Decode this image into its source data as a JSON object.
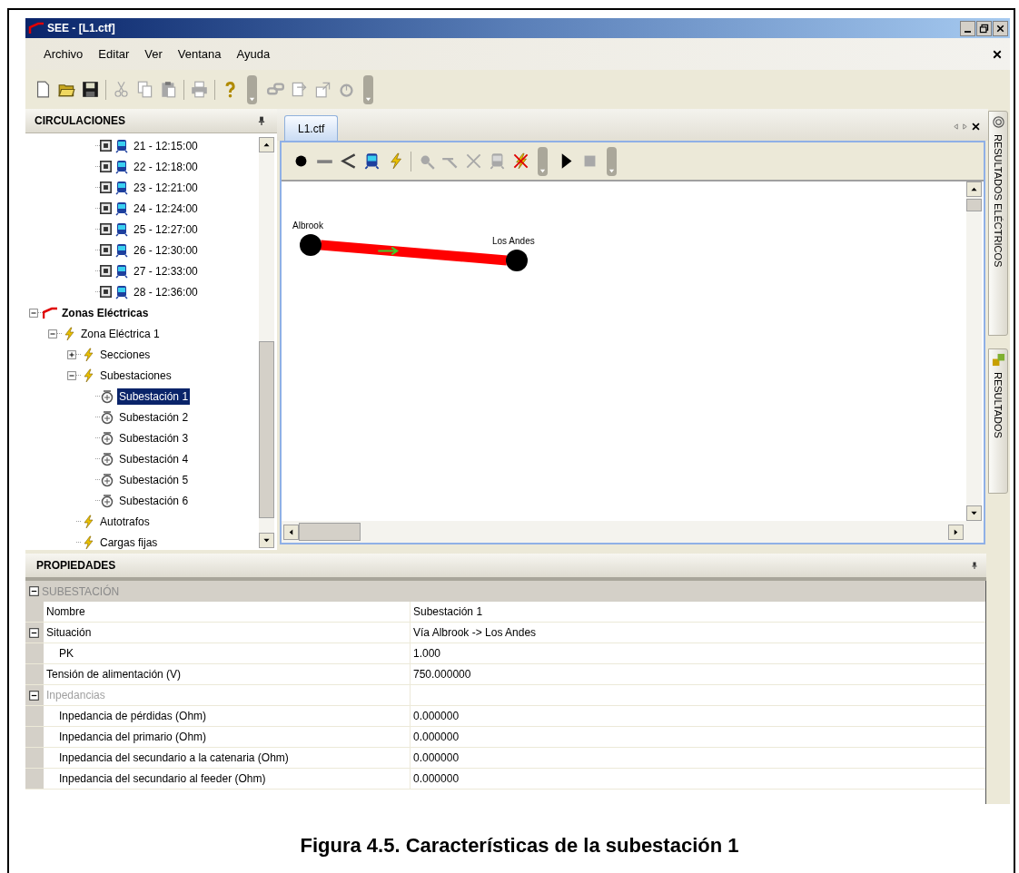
{
  "window": {
    "title": "SEE - [L1.ctf]"
  },
  "menu": [
    "Archivo",
    "Editar",
    "Ver",
    "Ventana",
    "Ayuda"
  ],
  "toolbars": [
    {
      "buttons": [
        {
          "kind": "new",
          "disabled": false
        },
        {
          "kind": "open",
          "disabled": false
        },
        {
          "kind": "save",
          "disabled": false
        },
        {
          "kind": "separator"
        },
        {
          "kind": "cut",
          "disabled": true
        },
        {
          "kind": "copy",
          "disabled": true
        },
        {
          "kind": "paste",
          "disabled": true
        },
        {
          "kind": "separator"
        },
        {
          "kind": "print",
          "disabled": true
        },
        {
          "kind": "separator"
        },
        {
          "kind": "help",
          "disabled": false
        }
      ]
    },
    {
      "buttons": [
        {
          "kind": "link",
          "disabled": true
        },
        {
          "kind": "import",
          "disabled": true
        },
        {
          "kind": "export",
          "disabled": true
        },
        {
          "kind": "probe",
          "disabled": true
        }
      ]
    }
  ],
  "left_panel": {
    "title": "CIRCULACIONES",
    "tree": {
      "scrolled_items": [
        {
          "label": "21 - 12:15:00",
          "checked": true,
          "selected": false
        },
        {
          "label": "22 - 12:18:00",
          "checked": true,
          "selected": false
        },
        {
          "label": "23 - 12:21:00",
          "checked": true,
          "selected": false
        },
        {
          "label": "24 - 12:24:00",
          "checked": true,
          "selected": false
        },
        {
          "label": "25 - 12:27:00",
          "checked": true,
          "selected": false
        },
        {
          "label": "26 - 12:30:00",
          "checked": true,
          "selected": false
        },
        {
          "label": "27 - 12:33:00",
          "checked": true,
          "selected": false
        },
        {
          "label": "28 - 12:36:00",
          "checked": true,
          "selected": false
        }
      ],
      "items": [
        {
          "label": "Zonas Eléctricas",
          "kind": "zones",
          "expanded": true,
          "selected": false,
          "children": [
            {
              "label": "Zona Eléctrica 1",
              "kind": "zone",
              "expanded": true,
              "selected": false,
              "children": [
                {
                  "label": "Secciones",
                  "kind": "zone",
                  "expanded": false,
                  "selected": false
                },
                {
                  "label": "Subestaciones",
                  "kind": "zone",
                  "expanded": true,
                  "selected": false,
                  "children": [
                    {
                      "label": "Subestación 1",
                      "kind": "substation",
                      "selected": true
                    },
                    {
                      "label": "Subestación 2",
                      "kind": "substation",
                      "selected": false
                    },
                    {
                      "label": "Subestación 3",
                      "kind": "substation",
                      "selected": false
                    },
                    {
                      "label": "Subestación 4",
                      "kind": "substation",
                      "selected": false
                    },
                    {
                      "label": "Subestación 5",
                      "kind": "substation",
                      "selected": false
                    },
                    {
                      "label": "Subestación 6",
                      "kind": "substation",
                      "selected": false
                    }
                  ]
                },
                {
                  "label": "Autotrafos",
                  "kind": "zone",
                  "selected": false
                },
                {
                  "label": "Cargas fijas",
                  "kind": "zone",
                  "selected": false
                }
              ]
            }
          ]
        }
      ]
    }
  },
  "document": {
    "tabs": [
      {
        "label": "L1.ctf",
        "selected": true
      }
    ],
    "toolbars": [
      {
        "buttons": [
          {
            "kind": "node",
            "disabled": false
          },
          {
            "kind": "line",
            "disabled": false
          },
          {
            "kind": "branch",
            "disabled": false
          },
          {
            "kind": "train",
            "disabled": false
          },
          {
            "kind": "bolt",
            "disabled": false
          },
          {
            "kind": "separator"
          },
          {
            "kind": "select_node",
            "disabled": true
          },
          {
            "kind": "select_line",
            "disabled": true
          },
          {
            "kind": "cut_line",
            "disabled": true
          },
          {
            "kind": "select_train",
            "disabled": true
          },
          {
            "kind": "delete",
            "disabled": false
          }
        ]
      },
      {
        "buttons": [
          {
            "kind": "play",
            "disabled": false
          },
          {
            "kind": "stop",
            "disabled": true
          }
        ]
      }
    ],
    "diagram": {
      "nodes": [
        {
          "label": "Albrook"
        },
        {
          "label": "Los Andes"
        }
      ]
    }
  },
  "side_tabs": [
    {
      "label": "RESULTADOS ELÉCTRICOS",
      "kind": "electric"
    },
    {
      "label": "RESULTADOS",
      "kind": "results"
    }
  ],
  "properties": {
    "title": "PROPIEDADES",
    "rows": [
      {
        "kind": "category",
        "name": "SUBESTACIÓN",
        "expanded": true,
        "children": [
          {
            "kind": "property",
            "name": "Nombre",
            "value": "Subestación 1"
          },
          {
            "kind": "group",
            "name": "Situación",
            "value": "Vía Albrook -> Los Andes",
            "expanded": true,
            "disabled": false,
            "children": [
              {
                "kind": "property",
                "name": "PK",
                "value": "1.000"
              }
            ]
          },
          {
            "kind": "property",
            "name": "Tensión de alimentación (V)",
            "value": "750.000000"
          },
          {
            "kind": "group",
            "name": "Inpedancias",
            "expanded": true,
            "disabled": true,
            "children": [
              {
                "kind": "property",
                "name": "Inpedancia de pérdidas (Ohm)",
                "value": "0.000000"
              },
              {
                "kind": "property",
                "name": "Inpedancia del primario (Ohm)",
                "value": "0.000000"
              },
              {
                "kind": "property",
                "name": "Inpedancia del secundario a la catenaria (Ohm)",
                "value": "0.000000"
              },
              {
                "kind": "property",
                "name": "Inpedancia del secundario al feeder (Ohm)",
                "value": "0.000000"
              }
            ]
          }
        ]
      }
    ]
  },
  "caption": "Figura 4.5. Características de la subestación 1"
}
